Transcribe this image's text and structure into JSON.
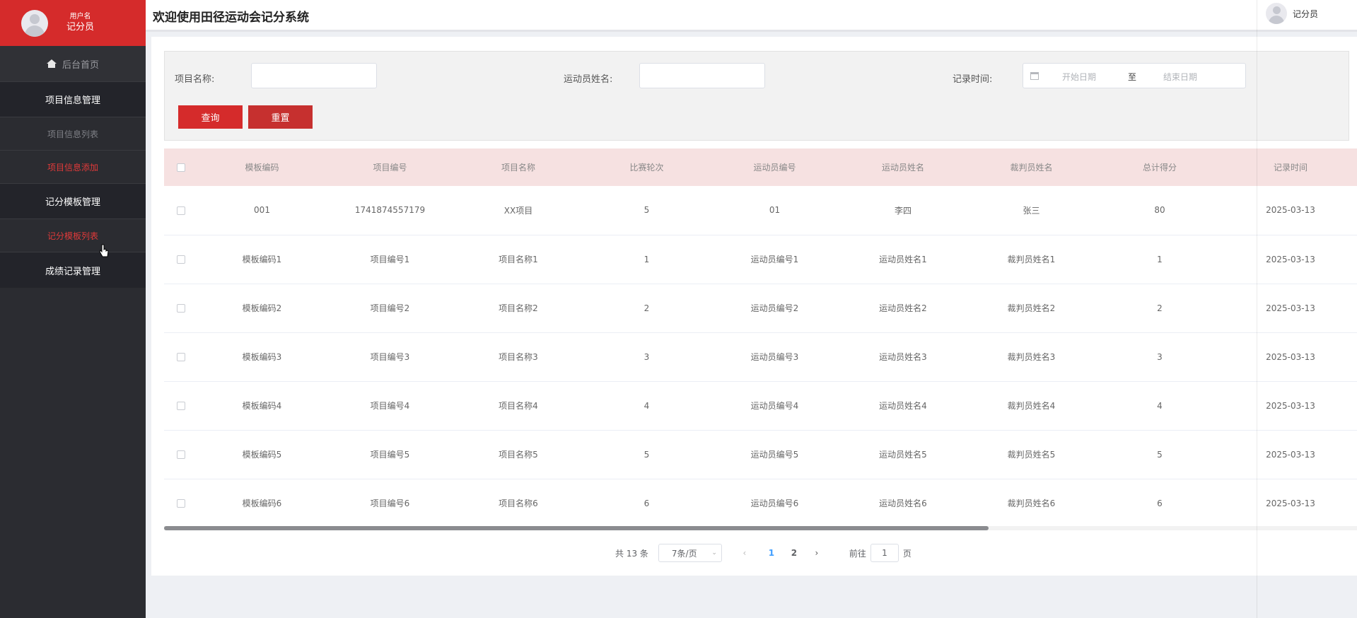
{
  "user": {
    "role_label": "用户名",
    "role": "记分员"
  },
  "header": {
    "title": "欢迎使用田径运动会记分系统",
    "user": "记分员"
  },
  "sidebar": {
    "home": "后台首页",
    "items": [
      {
        "label": "项目信息管理"
      },
      {
        "label": "项目信息列表"
      },
      {
        "label": "项目信息添加"
      },
      {
        "label": "记分模板管理"
      },
      {
        "label": "记分模板列表"
      },
      {
        "label": "成绩记录管理"
      }
    ]
  },
  "search": {
    "project_label": "项目名称:",
    "athlete_label": "运动员姓名:",
    "time_label": "记录时间:",
    "start_placeholder": "开始日期",
    "separator": "至",
    "end_placeholder": "结束日期",
    "query_btn": "查询",
    "reset_btn": "重置"
  },
  "table": {
    "headers": [
      "模板编码",
      "项目编号",
      "项目名称",
      "比赛轮次",
      "运动员编号",
      "运动员姓名",
      "裁判员姓名",
      "总计得分",
      "记录时间"
    ],
    "rows": [
      [
        "001",
        "1741874557179",
        "XX项目",
        "5",
        "01",
        "李四",
        "张三",
        "80",
        "2025-03-13"
      ],
      [
        "模板编码1",
        "项目编号1",
        "项目名称1",
        "1",
        "运动员编号1",
        "运动员姓名1",
        "裁判员姓名1",
        "1",
        "2025-03-13"
      ],
      [
        "模板编码2",
        "项目编号2",
        "项目名称2",
        "2",
        "运动员编号2",
        "运动员姓名2",
        "裁判员姓名2",
        "2",
        "2025-03-13"
      ],
      [
        "模板编码3",
        "项目编号3",
        "项目名称3",
        "3",
        "运动员编号3",
        "运动员姓名3",
        "裁判员姓名3",
        "3",
        "2025-03-13"
      ],
      [
        "模板编码4",
        "项目编号4",
        "项目名称4",
        "4",
        "运动员编号4",
        "运动员姓名4",
        "裁判员姓名4",
        "4",
        "2025-03-13"
      ],
      [
        "模板编码5",
        "项目编号5",
        "项目名称5",
        "5",
        "运动员编号5",
        "运动员姓名5",
        "裁判员姓名5",
        "5",
        "2025-03-13"
      ],
      [
        "模板编码6",
        "项目编号6",
        "项目名称6",
        "6",
        "运动员编号6",
        "运动员姓名6",
        "裁判员姓名6",
        "6",
        "2025-03-13"
      ]
    ]
  },
  "pagination": {
    "total": "共 13 条",
    "page_size": "7条/页",
    "pages": [
      "1",
      "2"
    ],
    "goto_label": "前往",
    "goto_value": "1",
    "page_suffix": "页"
  }
}
